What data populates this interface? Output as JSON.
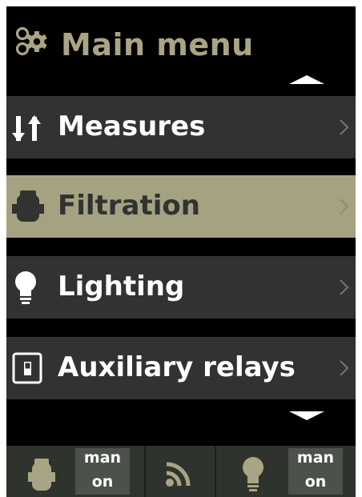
{
  "header": {
    "title": "Main menu",
    "icon": "settings-gear-icon"
  },
  "colors": {
    "accent": "#a9a483",
    "item_bg": "#303330",
    "selected_bg": "#a4a281",
    "background": "#000000"
  },
  "menu": {
    "items": [
      {
        "label": "Measures",
        "icon": "up-down-arrows-icon",
        "selected": false
      },
      {
        "label": "Filtration",
        "icon": "pump-icon",
        "selected": true
      },
      {
        "label": "Lighting",
        "icon": "light-bulb-icon",
        "selected": false
      },
      {
        "label": "Auxiliary relays",
        "icon": "relay-switch-icon",
        "selected": false
      }
    ]
  },
  "statusbar": {
    "filtration": {
      "icon": "pump-icon",
      "mode": "man",
      "state": "on"
    },
    "connection": {
      "icon": "wifi-signal-icon"
    },
    "lighting": {
      "icon": "light-bulb-icon",
      "mode": "man",
      "state": "on"
    }
  }
}
